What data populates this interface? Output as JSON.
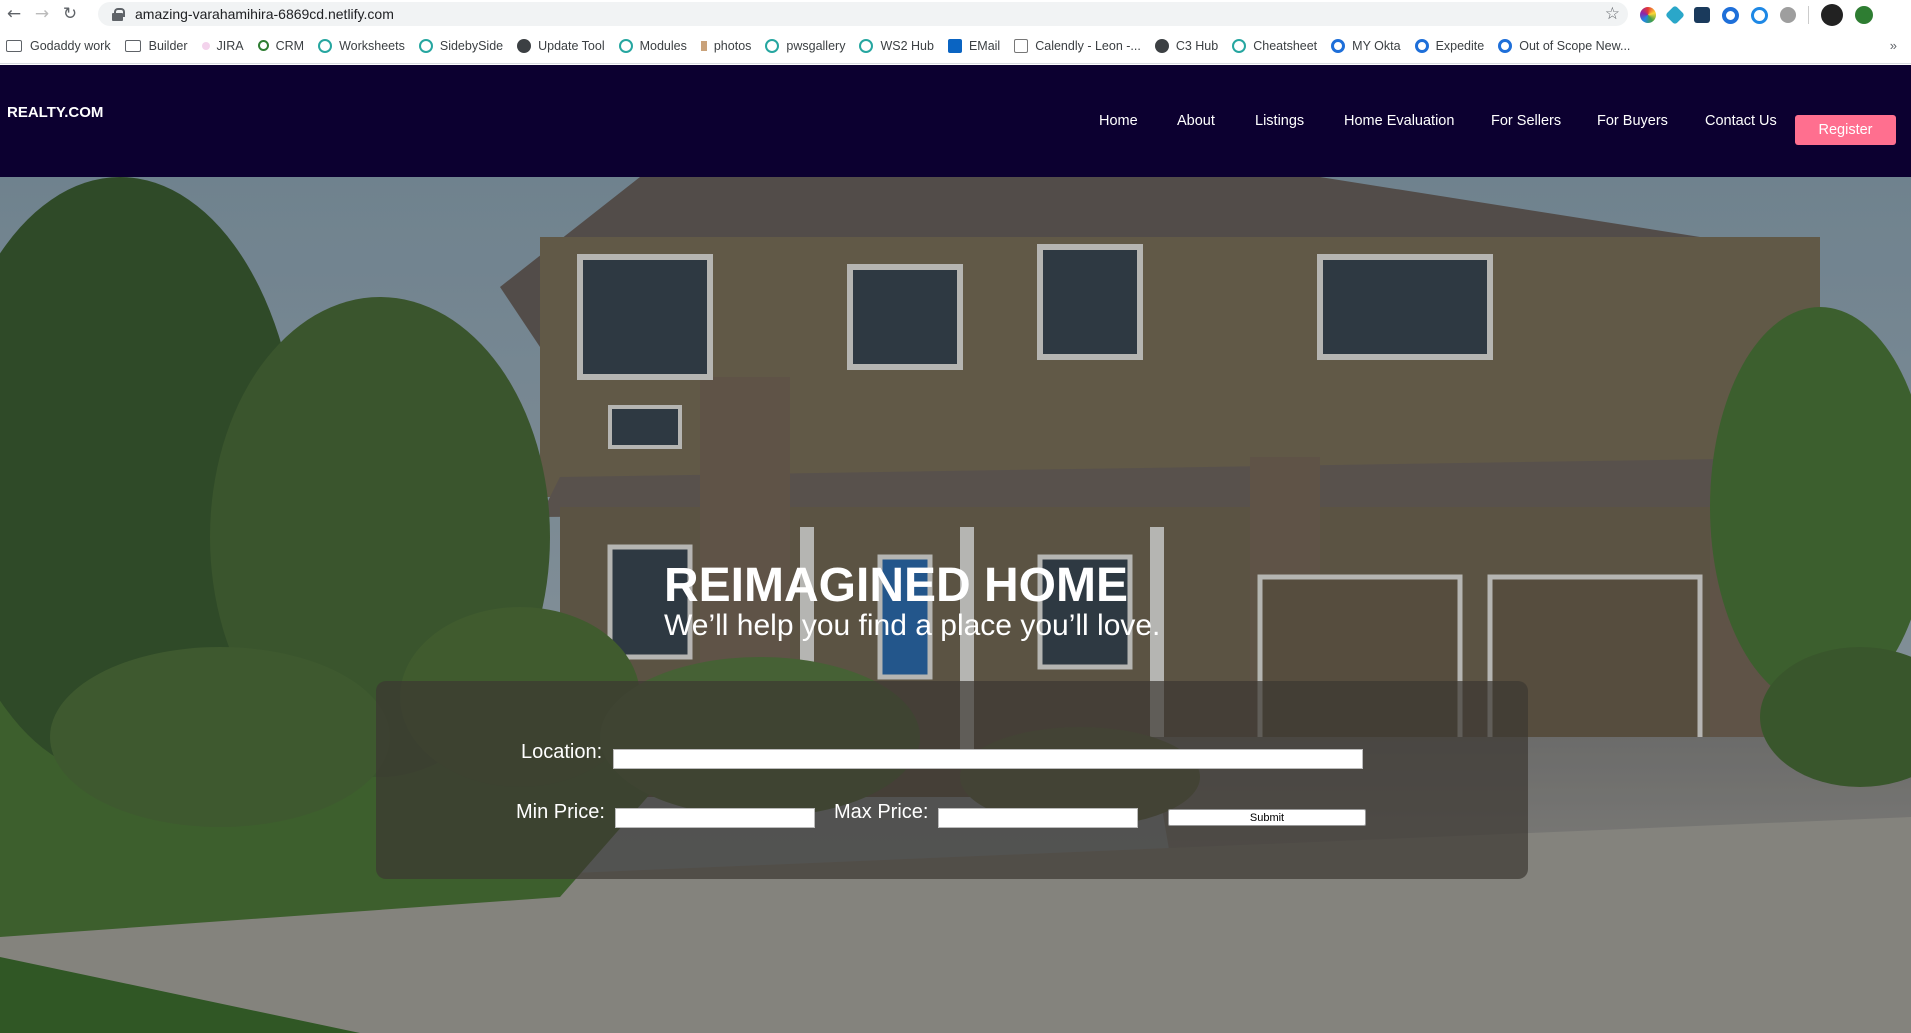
{
  "browser": {
    "url": "amazing-varahamihira-6869cd.netlify.com",
    "bookmarks": [
      {
        "label": "Godaddy work",
        "icon": "folder-icon"
      },
      {
        "label": "Builder",
        "icon": "folder-icon"
      },
      {
        "label": "JIRA",
        "icon": "jira-icon"
      },
      {
        "label": "CRM",
        "icon": "search-icon"
      },
      {
        "label": "Worksheets",
        "icon": "heart-icon"
      },
      {
        "label": "SidebySide",
        "icon": "heart-icon"
      },
      {
        "label": "Update Tool",
        "icon": "globe-icon"
      },
      {
        "label": "Modules",
        "icon": "heart-icon"
      },
      {
        "label": "photos",
        "icon": "photos-icon"
      },
      {
        "label": "pwsgallery",
        "icon": "heart-icon"
      },
      {
        "label": "WS2 Hub",
        "icon": "heart-icon"
      },
      {
        "label": "EMail",
        "icon": "outlook-icon"
      },
      {
        "label": "Calendly - Leon -...",
        "icon": "calendar-icon"
      },
      {
        "label": "C3 Hub",
        "icon": "globe-icon"
      },
      {
        "label": "Cheatsheet",
        "icon": "heart-icon"
      },
      {
        "label": "MY Okta",
        "icon": "okta-icon"
      },
      {
        "label": "Expedite",
        "icon": "okta-icon"
      },
      {
        "label": "Out of Scope New...",
        "icon": "okta-icon"
      }
    ],
    "bookmarks_more": "»"
  },
  "site": {
    "logo": "REALTY.COM",
    "nav": [
      "Home",
      "About",
      "Listings",
      "Home Evaluation",
      "For Sellers",
      "For Buyers",
      "Contact Us"
    ],
    "register_label": "Register",
    "accent_color": "#ff6f8f",
    "header_color": "#0c0030"
  },
  "hero": {
    "title": "REIMAGINED HOME",
    "subtitle": "We’ll help you find a place you’ll love."
  },
  "search": {
    "location_label": "Location:",
    "location_value": "",
    "min_price_label": "Min Price:",
    "min_price_value": "",
    "max_price_label": "Max Price:",
    "max_price_value": "",
    "submit_label": "Submit"
  }
}
